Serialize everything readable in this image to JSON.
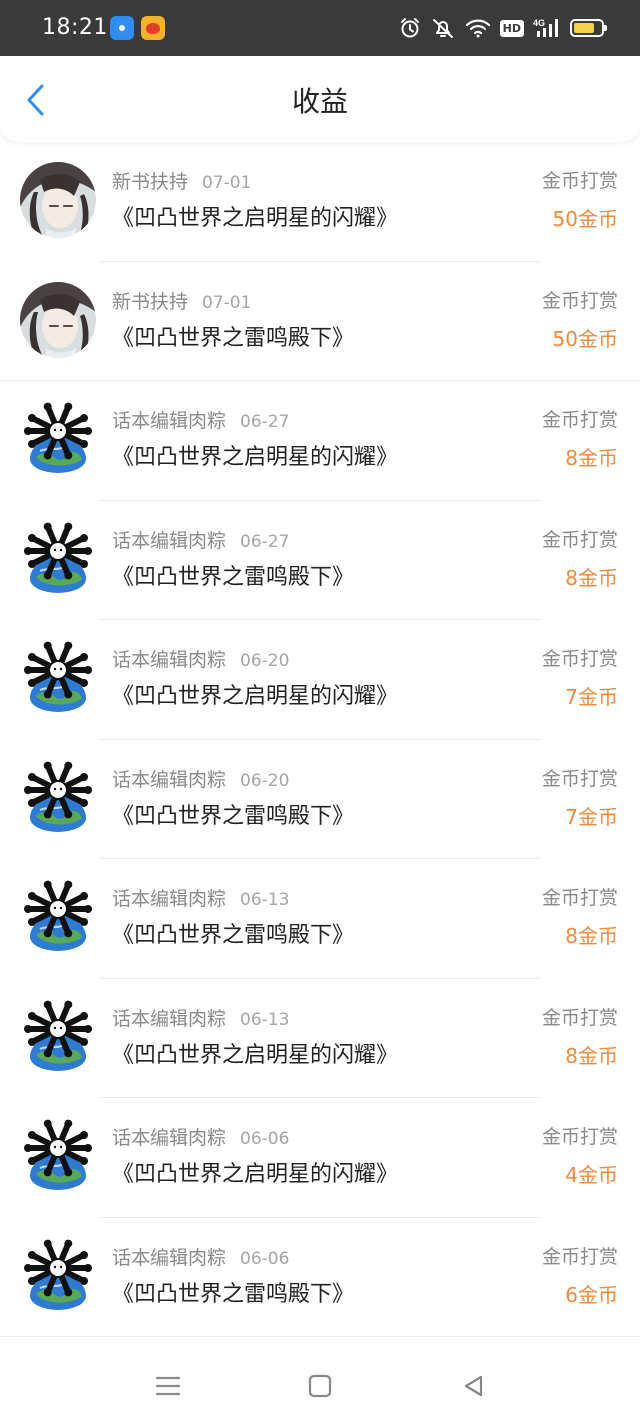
{
  "status_bar": {
    "time": "18:21",
    "app_icons": [
      "browser-app-icon",
      "weibo-app-icon"
    ],
    "icons": [
      "alarm-icon",
      "mute-icon",
      "wifi-icon",
      "hd-icon",
      "signal-icon",
      "battery-icon"
    ],
    "hd_label": "HD",
    "network_label": "4G",
    "battery_level": 0.75
  },
  "header": {
    "title": "收益",
    "back_icon": "chevron-left-icon"
  },
  "colors": {
    "accent_blue": "#2f8cf0",
    "amount_orange": "#f08a3c",
    "muted_text": "#8a8a8a"
  },
  "records": [
    {
      "avatar": "anime-avatar",
      "sender": "新书扶持",
      "date": "07-01",
      "book": "《凹凸世界之启明星的闪耀》",
      "type": "金币打赏",
      "amount": "50金币"
    },
    {
      "avatar": "anime-avatar",
      "sender": "新书扶持",
      "date": "07-01",
      "book": "《凹凸世界之雷鸣殿下》",
      "type": "金币打赏",
      "amount": "50金币"
    },
    {
      "avatar": "globe-avatar",
      "sender": "话本编辑肉粽",
      "date": "06-27",
      "book": "《凹凸世界之启明星的闪耀》",
      "type": "金币打赏",
      "amount": "8金币"
    },
    {
      "avatar": "globe-avatar",
      "sender": "话本编辑肉粽",
      "date": "06-27",
      "book": "《凹凸世界之雷鸣殿下》",
      "type": "金币打赏",
      "amount": "8金币"
    },
    {
      "avatar": "globe-avatar",
      "sender": "话本编辑肉粽",
      "date": "06-20",
      "book": "《凹凸世界之启明星的闪耀》",
      "type": "金币打赏",
      "amount": "7金币"
    },
    {
      "avatar": "globe-avatar",
      "sender": "话本编辑肉粽",
      "date": "06-20",
      "book": "《凹凸世界之雷鸣殿下》",
      "type": "金币打赏",
      "amount": "7金币"
    },
    {
      "avatar": "globe-avatar",
      "sender": "话本编辑肉粽",
      "date": "06-13",
      "book": "《凹凸世界之雷鸣殿下》",
      "type": "金币打赏",
      "amount": "8金币"
    },
    {
      "avatar": "globe-avatar",
      "sender": "话本编辑肉粽",
      "date": "06-13",
      "book": "《凹凸世界之启明星的闪耀》",
      "type": "金币打赏",
      "amount": "8金币"
    },
    {
      "avatar": "globe-avatar",
      "sender": "话本编辑肉粽",
      "date": "06-06",
      "book": "《凹凸世界之启明星的闪耀》",
      "type": "金币打赏",
      "amount": "4金币"
    },
    {
      "avatar": "globe-avatar",
      "sender": "话本编辑肉粽",
      "date": "06-06",
      "book": "《凹凸世界之雷鸣殿下》",
      "type": "金币打赏",
      "amount": "6金币"
    }
  ],
  "nav_bar": {
    "buttons": [
      "menu-icon",
      "home-square-icon",
      "back-triangle-icon"
    ]
  }
}
